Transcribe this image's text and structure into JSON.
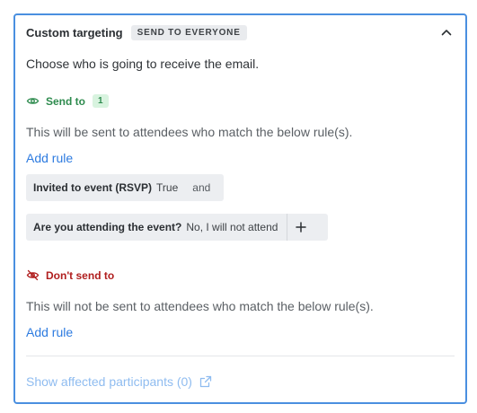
{
  "header": {
    "title": "Custom targeting",
    "badge": "SEND TO EVERYONE"
  },
  "intro": "Choose who is going to receive the email.",
  "send": {
    "label": "Send to",
    "count": "1",
    "description": "This will be sent to attendees who match the below rule(s).",
    "add_rule": "Add rule",
    "rules": [
      {
        "key": "Invited to event (RSVP)",
        "value": "True",
        "joiner": "and"
      },
      {
        "key": "Are you attending the event?",
        "value": "No, I will not attend"
      }
    ]
  },
  "dont_send": {
    "label": "Don't send to",
    "description": "This will not be sent to attendees who match the below rule(s).",
    "add_rule": "Add rule"
  },
  "footer": {
    "show_affected": "Show affected participants (0)"
  },
  "colors": {
    "accent": "#2d7be0",
    "send": "#2e8b4e",
    "dont_send": "#b01e1e",
    "border": "#4a8fe0"
  },
  "icons": {
    "collapse": "chevron-up-icon",
    "send": "eye-icon",
    "dont_send": "eye-off-icon",
    "external": "external-link-icon",
    "add": "plus-icon"
  }
}
